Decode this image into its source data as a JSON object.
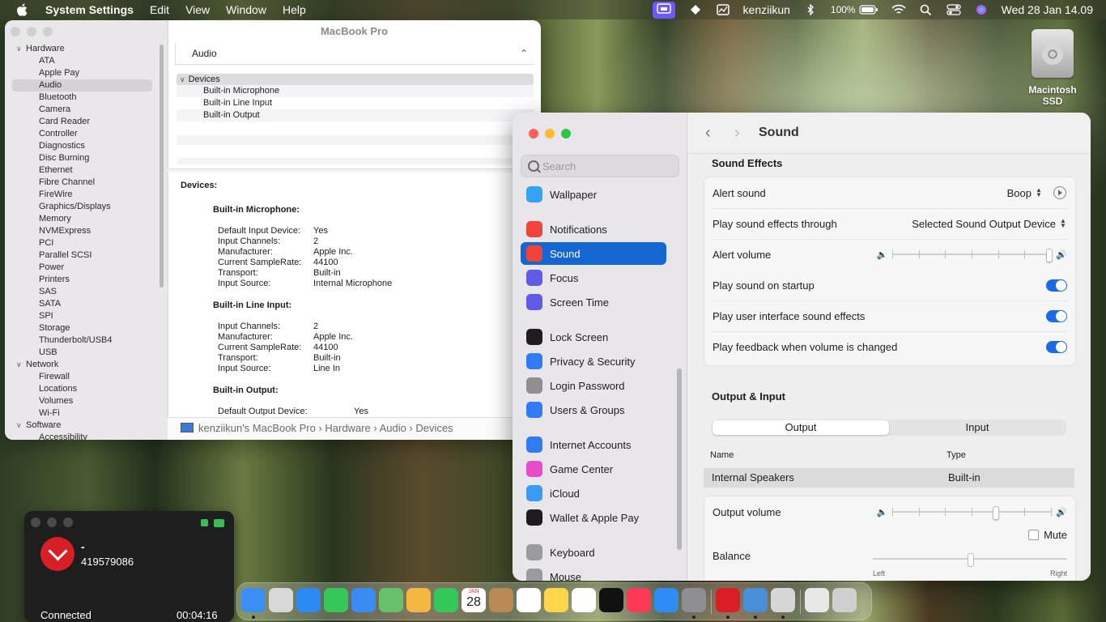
{
  "menubar": {
    "app_name": "System Settings",
    "menus": [
      "Edit",
      "View",
      "Window",
      "Help"
    ],
    "user": "kenziikun",
    "battery": "100%",
    "datetime": "Wed 28 Jan  14.09"
  },
  "desktop": {
    "disk_label": "Macintosh SSD"
  },
  "sysinfo": {
    "title": "MacBook Pro",
    "sidebar": {
      "hardware_label": "Hardware",
      "hardware_items": [
        "ATA",
        "Apple Pay",
        "Audio",
        "Bluetooth",
        "Camera",
        "Card Reader",
        "Controller",
        "Diagnostics",
        "Disc Burning",
        "Ethernet",
        "Fibre Channel",
        "FireWire",
        "Graphics/Displays",
        "Memory",
        "NVMExpress",
        "PCI",
        "Parallel SCSI",
        "Power",
        "Printers",
        "SAS",
        "SATA",
        "SPI",
        "Storage",
        "Thunderbolt/USB4",
        "USB"
      ],
      "network_label": "Network",
      "network_items": [
        "Firewall",
        "Locations",
        "Volumes",
        "Wi-Fi"
      ],
      "software_label": "Software",
      "software_items": [
        "Accessibility"
      ]
    },
    "header_label": "Audio",
    "devices_label": "Devices",
    "devices": [
      "Built-in Microphone",
      "Built-in Line Input",
      "Built-in Output"
    ],
    "detail": {
      "heading": "Devices:",
      "mic_title": "Built-in Microphone:",
      "mic": [
        {
          "k": "Default Input Device:",
          "v": "Yes"
        },
        {
          "k": "Input Channels:",
          "v": "2"
        },
        {
          "k": "Manufacturer:",
          "v": "Apple Inc."
        },
        {
          "k": "Current SampleRate:",
          "v": "44100"
        },
        {
          "k": "Transport:",
          "v": "Built-in"
        },
        {
          "k": "Input Source:",
          "v": "Internal Microphone"
        }
      ],
      "line_title": "Built-in Line Input:",
      "line": [
        {
          "k": "Input Channels:",
          "v": "2"
        },
        {
          "k": "Manufacturer:",
          "v": "Apple Inc."
        },
        {
          "k": "Current SampleRate:",
          "v": "44100"
        },
        {
          "k": "Transport:",
          "v": "Built-in"
        },
        {
          "k": "Input Source:",
          "v": "Line In"
        }
      ],
      "out_title": "Built-in Output:",
      "out": [
        {
          "k": "Default Output Device:",
          "v": "Yes"
        }
      ]
    },
    "path": [
      "kenziikun's MacBook Pro",
      "Hardware",
      "Audio",
      "Devices"
    ]
  },
  "settings": {
    "search_placeholder": "Search",
    "sidebar": [
      {
        "label": "Wallpaper",
        "icon": "wallpaper-icon",
        "color": "#35a3f4"
      },
      {
        "label": "Notifications",
        "icon": "notifications-icon",
        "color": "#f0443a"
      },
      {
        "label": "Sound",
        "icon": "sound-icon",
        "color": "#f0443a"
      },
      {
        "label": "Focus",
        "icon": "focus-icon",
        "color": "#5e5ce6"
      },
      {
        "label": "Screen Time",
        "icon": "screen-time-icon",
        "color": "#5e5ce6"
      },
      {
        "label": "Lock Screen",
        "icon": "lock-screen-icon",
        "color": "#1d1d1f"
      },
      {
        "label": "Privacy & Security",
        "icon": "privacy-icon",
        "color": "#2f7cf6"
      },
      {
        "label": "Login Password",
        "icon": "login-password-icon",
        "color": "#8e8e93"
      },
      {
        "label": "Users & Groups",
        "icon": "users-groups-icon",
        "color": "#2f7cf6"
      },
      {
        "label": "Internet Accounts",
        "icon": "internet-accounts-icon",
        "color": "#2f7cf6"
      },
      {
        "label": "Game Center",
        "icon": "game-center-icon",
        "color": "#e84cc8"
      },
      {
        "label": "iCloud",
        "icon": "icloud-icon",
        "color": "#3a9df5"
      },
      {
        "label": "Wallet & Apple Pay",
        "icon": "wallet-icon",
        "color": "#1d1d1f"
      },
      {
        "label": "Keyboard",
        "icon": "keyboard-icon",
        "color": "#9a9a9f"
      },
      {
        "label": "Mouse",
        "icon": "mouse-icon",
        "color": "#9a9a9f"
      }
    ],
    "title": "Sound",
    "sound_effects_title": "Sound Effects",
    "alert_sound_label": "Alert sound",
    "alert_sound_value": "Boop",
    "play_through_label": "Play sound effects through",
    "play_through_value": "Selected Sound Output Device",
    "alert_volume_label": "Alert volume",
    "alert_volume_level": 1.0,
    "toggles": [
      {
        "label": "Play sound on startup",
        "on": true
      },
      {
        "label": "Play user interface sound effects",
        "on": true
      },
      {
        "label": "Play feedback when volume is changed",
        "on": true
      }
    ],
    "output_input_title": "Output & Input",
    "tabs": [
      "Output",
      "Input"
    ],
    "col_name": "Name",
    "col_type": "Type",
    "device_name": "Internal Speakers",
    "device_type": "Built-in",
    "output_volume_label": "Output volume",
    "output_volume_level": 0.65,
    "mute_label": "Mute",
    "balance_label": "Balance",
    "balance_level": 0.5,
    "balance_left": "Left",
    "balance_right": "Right",
    "accent": "#1466d3"
  },
  "call": {
    "name": "-",
    "number": "419579086",
    "status": "Connected",
    "duration": "00:04:16"
  },
  "dock": [
    {
      "name": "finder",
      "color": "#3c8ef3"
    },
    {
      "name": "launchpad",
      "color": "#d8d8d8"
    },
    {
      "name": "safari",
      "color": "#2b8af3"
    },
    {
      "name": "messages",
      "color": "#34c759"
    },
    {
      "name": "mail",
      "color": "#3b8bf5"
    },
    {
      "name": "maps",
      "color": "#66c26a"
    },
    {
      "name": "photos",
      "color": "#f5b642"
    },
    {
      "name": "facetime",
      "color": "#34c759"
    },
    {
      "name": "calendar",
      "color": "#ffffff"
    },
    {
      "name": "contacts",
      "color": "#b88a55"
    },
    {
      "name": "reminders",
      "color": "#ffffff"
    },
    {
      "name": "notes",
      "color": "#ffd54a"
    },
    {
      "name": "freeform",
      "color": "#ffffff"
    },
    {
      "name": "tv",
      "color": "#111111"
    },
    {
      "name": "music",
      "color": "#fb3b55"
    },
    {
      "name": "app-store",
      "color": "#2f8cf5"
    },
    {
      "name": "system-settings",
      "color": "#8e8e93"
    },
    {
      "name": "call-app",
      "color": "#d91f26"
    },
    {
      "name": "system-information",
      "color": "#4a8ed8"
    },
    {
      "name": "printer",
      "color": "#d6d6d6"
    },
    {
      "name": "documents",
      "color": "#e8e8e8"
    },
    {
      "name": "trash",
      "color": "#cfcfcf"
    }
  ],
  "dock_calendar": {
    "month": "JAN",
    "day": "28"
  }
}
